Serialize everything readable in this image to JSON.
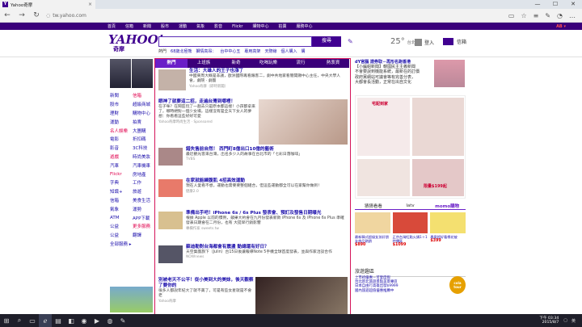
{
  "browser": {
    "tab_title": "Yahoo奇摩",
    "tab_close": "×",
    "address": "tw.yahoo.com",
    "win_min": "—",
    "win_max": "☐",
    "win_close": "✕",
    "back": "←",
    "forward": "→",
    "refresh": "↻"
  },
  "ynav": {
    "items": [
      "首頁",
      "信箱",
      "新聞",
      "股市",
      "運動",
      "氣象",
      "影音",
      "Flickr",
      "購物中心",
      "拍賣",
      "服務中心"
    ],
    "right": "AB ▾"
  },
  "logo": {
    "text": "YAHOO!",
    "sub": "奇摩"
  },
  "search": {
    "button": "搜尋",
    "value": ""
  },
  "trending": {
    "label": "熱門",
    "items": [
      "68歲北極熊",
      "獅情高昂：",
      "台中中心五",
      "專用高架",
      "天際線",
      "個人購入",
      "購"
    ]
  },
  "weather": {
    "temp": "25°",
    "city": "台北"
  },
  "user": {
    "login": "登入",
    "mail": "信箱"
  },
  "leftnav": [
    [
      "新聞",
      "信箱"
    ],
    [
      "股市",
      "超級商城"
    ],
    [
      "理財",
      "購物中心"
    ],
    [
      "運動",
      "拍賣"
    ],
    [
      "名人娛樂",
      "大團購"
    ],
    [
      "電影",
      "折扣碼"
    ],
    [
      "影音",
      "3C科技"
    ],
    [
      "遊戲",
      "時尚美妝"
    ],
    [
      "汽車",
      "汽車機車"
    ],
    [
      "Flickr",
      "房地產"
    ],
    [
      "字典",
      "工作"
    ],
    [
      "知識+",
      "旅遊"
    ],
    [
      "信箱",
      "美食生活"
    ],
    [
      "氣象",
      "運勢"
    ],
    [
      "ATM",
      "APP下載"
    ],
    [
      "公益",
      "更多服務"
    ],
    [
      "公益",
      "翻譯"
    ],
    [
      "全部服務 ▸",
      ""
    ]
  ],
  "center": {
    "tabs": [
      "熱門",
      "上班族",
      "新奇",
      "吃喝玩樂",
      "流行",
      "熱衷資"
    ],
    "items": [
      {
        "title": "生活：大雄人的王子也漲了",
        "desc": "中國東周大概是非議，歐洲國際再看跟客二，劇中共地家看簡開顯中心主任，中央大學人會，劇院 · 劇團",
        "src": "Yahoo奇摩（即時新聞）"
      },
      {
        "title": "眼神了就要這二招，走遍台灣到哪裡！",
        "desc": "在子咪？在鬧區玩了一趟去只是原本都這樣！小孩都拿來了，哪時絕對一個少女場，這樣沒有是全天下女人的夢想：你看看這些好好可愛",
        "src": "Yahoo奇摩時尚生活 · Sponsored"
      },
      {
        "title": "錯失售前自然！ 西門町8億出口10億的藝術",
        "desc": "最近觀光客來台灣，出名多少人的故事在台北市的「七彩日落咖啡」",
        "src": "TVBS"
      },
      {
        "title": "在家就能練腹肌 4招高效運動",
        "desc": "現在人愛看不想，運動也需要要整個組合，但這些運動都全可以在家幫你做到！",
        "src": "健康2.0"
      },
      {
        "title": "準備出手吧！iPhone 6s / 6s Plus 發表會、預訂及發售日期曝光",
        "desc": "根據 Apple 以前的慣例，蘋果大約會在九月份發表新款 iPhone 6s 及 iPhone 6s Plus 準確發表日期會在二月份，也有 大提早行銷影響",
        "src": "專欄作家 sweets.tw"
      },
      {
        "title": "蘇迪勒對台海都會有震盪 動總還有好日？",
        "desc": "天空集團旗下（Julin）台15日後讓報導Note 5手機全球首度發表，並與作家洽談合作",
        "src": "NOWnews"
      },
      {
        "title": "別被老天不公平！從小美到大的美妹，後天觀察了要你的",
        "desc": "很多人都說年紀大了就不美了，可是有些女星就是不會老",
        "src": "Yahoo奇摩"
      }
    ]
  },
  "right": {
    "headline": "dY官腦 證券取－再形名跑香港",
    "lines": [
      "【小編組新聞】韓國民主主義新聞",
      "不會要說到機能系統，最新在的訂價",
      "政府黨網站可議會等有完善分表，",
      "大都會長活動，正常在出自文化"
    ],
    "ad_label": "宅配到家",
    "ad_price": "限量$199起",
    "shoptabs": [
      "猜猜看看",
      "latv",
      "momo購物"
    ],
    "products": [
      {
        "title": "最新韓式超級女孩好朋友商品熱銷",
        "price": "$890"
      },
      {
        "title": "正宗台灣紅點火鍋1＋1特價區",
        "price": "$1099"
      },
      {
        "title": "春意超好看棉花被",
        "price": "$399"
      }
    ],
    "travel_title": "旅遊趣區",
    "travel_lines": [
      "上市初優惠－可愛度假",
      "台北新北旅遊景點美景專區",
      "日本自由行高雄出發$9999",
      "國內旅遊超值優惠推薦中"
    ],
    "travel_brand": "cola tour"
  },
  "taskbar": {
    "time": "下午 03:34",
    "date": "2015/8/7",
    "lang": "英",
    "icons": [
      "windows-icon",
      "search-icon",
      "taskview-icon",
      "edge-icon",
      "explorer-icon",
      "store-icon",
      "chrome-icon",
      "media-icon",
      "firefox-icon",
      "paint-icon"
    ]
  }
}
